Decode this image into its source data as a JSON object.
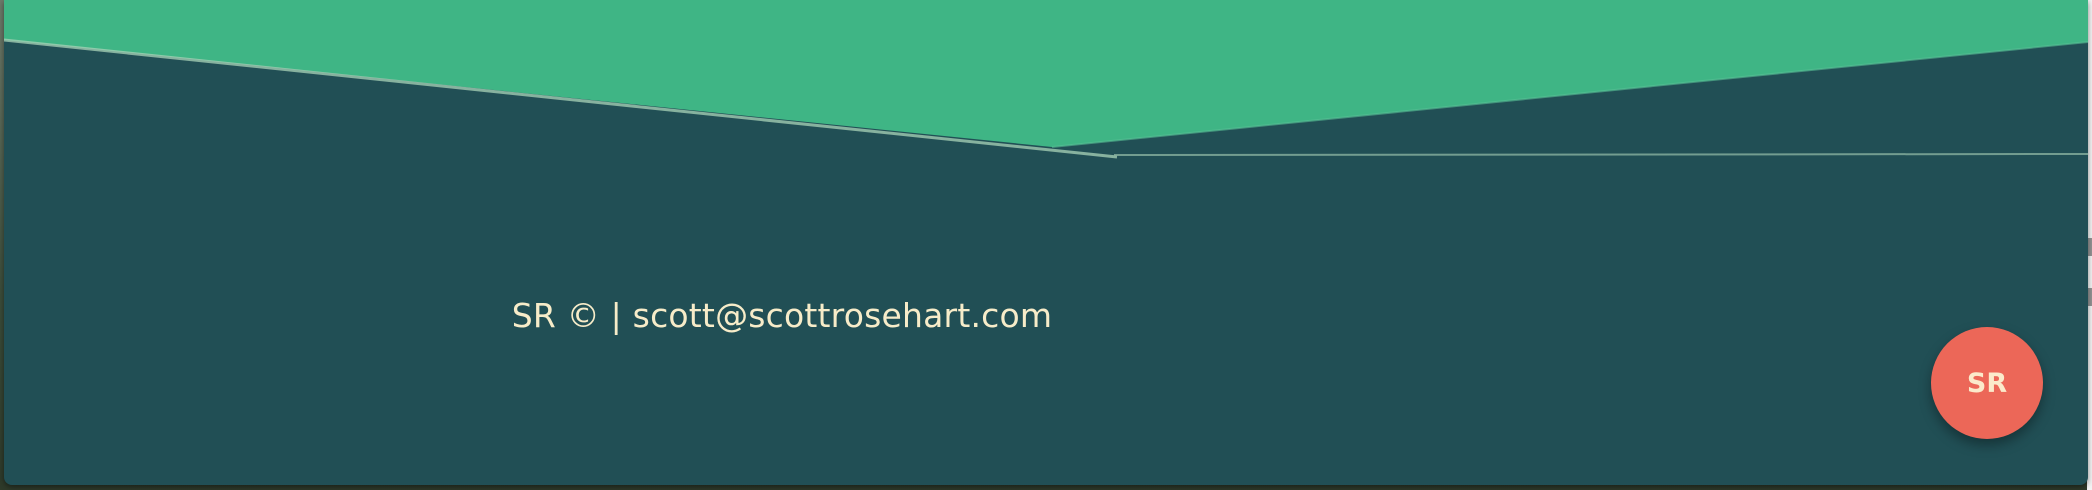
{
  "footer": {
    "initials": "SR",
    "copyright_symbol": "©",
    "separator": "|",
    "email": "scott@scottrosehart.com"
  },
  "fab": {
    "label": "SR"
  },
  "colors": {
    "hero_green": "#3fb585",
    "footer_teal": "#214f55",
    "footer_text": "#f7ecc9",
    "fab_coral": "#ec6758"
  }
}
